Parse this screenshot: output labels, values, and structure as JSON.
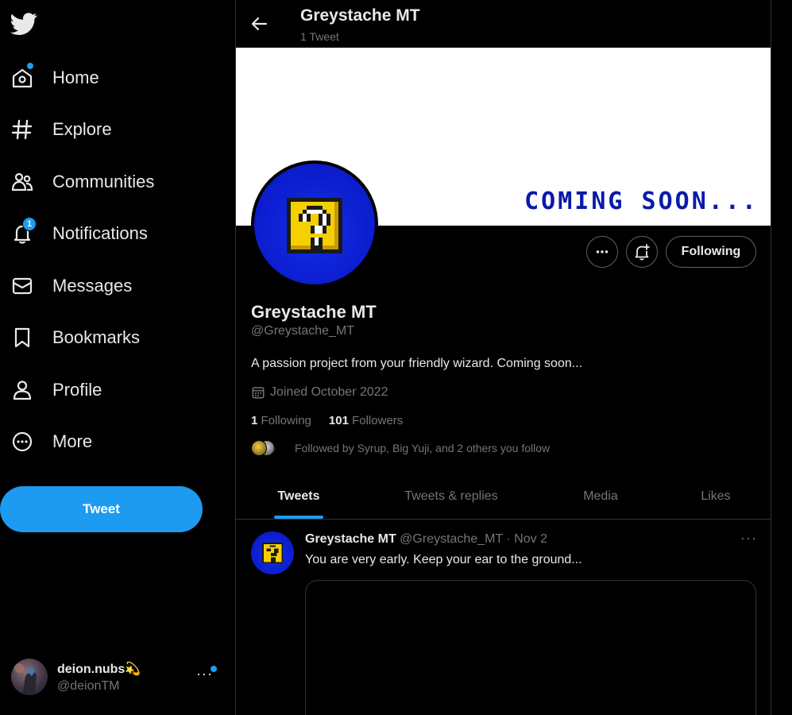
{
  "sidebar": {
    "items": [
      {
        "label": "Home",
        "icon": "home-icon"
      },
      {
        "label": "Explore",
        "icon": "hashtag-icon"
      },
      {
        "label": "Communities",
        "icon": "communities-icon"
      },
      {
        "label": "Notifications",
        "icon": "bell-icon"
      },
      {
        "label": "Messages",
        "icon": "envelope-icon"
      },
      {
        "label": "Bookmarks",
        "icon": "bookmark-icon"
      },
      {
        "label": "Profile",
        "icon": "person-icon"
      },
      {
        "label": "More",
        "icon": "more-circle-icon"
      }
    ],
    "notifications_count": "1",
    "tweet_button": "Tweet",
    "account": {
      "name": "deion.nubs💫",
      "handle": "@deionTM",
      "more": "···"
    }
  },
  "header": {
    "title": "Greystache MT",
    "subtitle": "1 Tweet"
  },
  "banner": {
    "text": "COMING SOON..."
  },
  "profile": {
    "name": "Greystache MT",
    "handle": "@Greystache_MT",
    "bio": "A passion project from your friendly wizard. Coming soon...",
    "joined": "Joined October 2022",
    "following_count": "1",
    "following_label": "Following",
    "followers_count": "101",
    "followers_label": "Followers",
    "followed_by": "Followed by Syrup, Big Yuji, and 2 others you follow",
    "following_button": "Following"
  },
  "tabs": [
    {
      "label": "Tweets",
      "active": true
    },
    {
      "label": "Tweets & replies",
      "active": false
    },
    {
      "label": "Media",
      "active": false
    },
    {
      "label": "Likes",
      "active": false
    }
  ],
  "tweet": {
    "name": "Greystache MT",
    "handle": "@Greystache_MT",
    "separator": "·",
    "date": "Nov 2",
    "text": "You are very early. Keep your ear to the ground...",
    "more": "···"
  },
  "colors": {
    "accent": "#1d9bf0",
    "background": "#000000",
    "text": "#e7e9ea",
    "muted": "#71767b",
    "border": "#2f3336",
    "avatar_blue": "#0c1ed0",
    "block_yellow": "#f5d000"
  }
}
